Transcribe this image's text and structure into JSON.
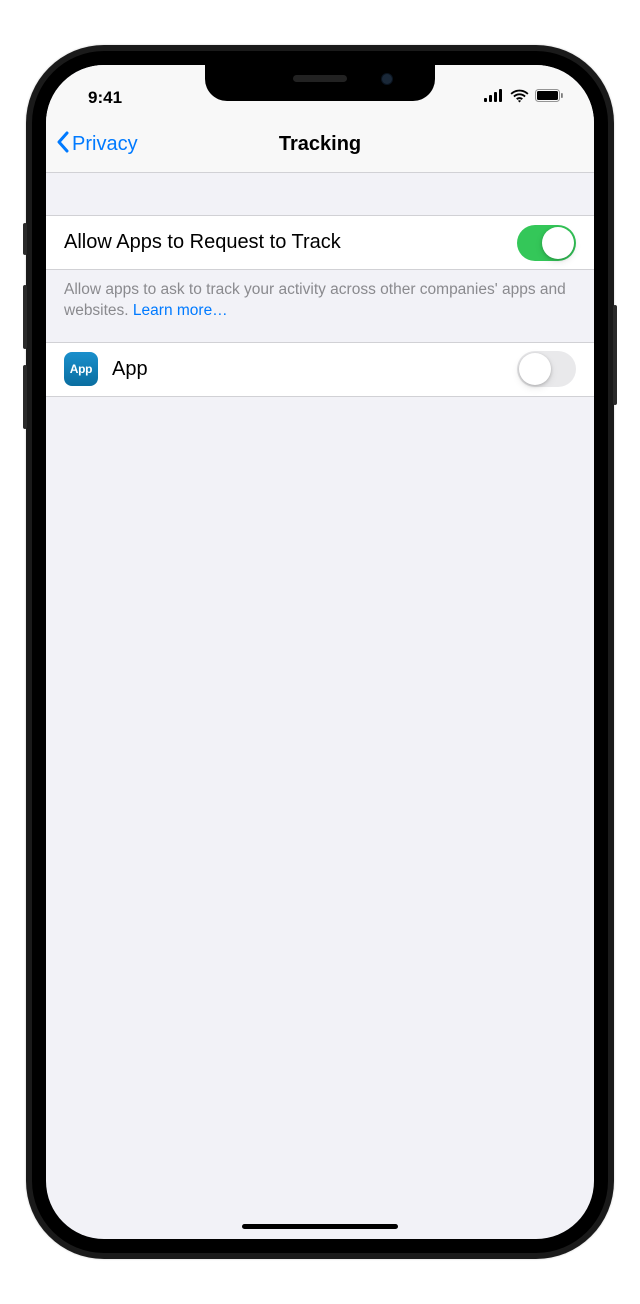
{
  "status": {
    "time": "9:41"
  },
  "nav": {
    "back_label": "Privacy",
    "title": "Tracking"
  },
  "tracking": {
    "allow_label": "Allow Apps to Request to Track",
    "allow_on": true,
    "footer_text": "Allow apps to ask to track your activity across other companies' apps and websites. ",
    "learn_more": "Learn more…"
  },
  "apps": [
    {
      "icon_text": "App",
      "name": "App",
      "on": false
    }
  ]
}
